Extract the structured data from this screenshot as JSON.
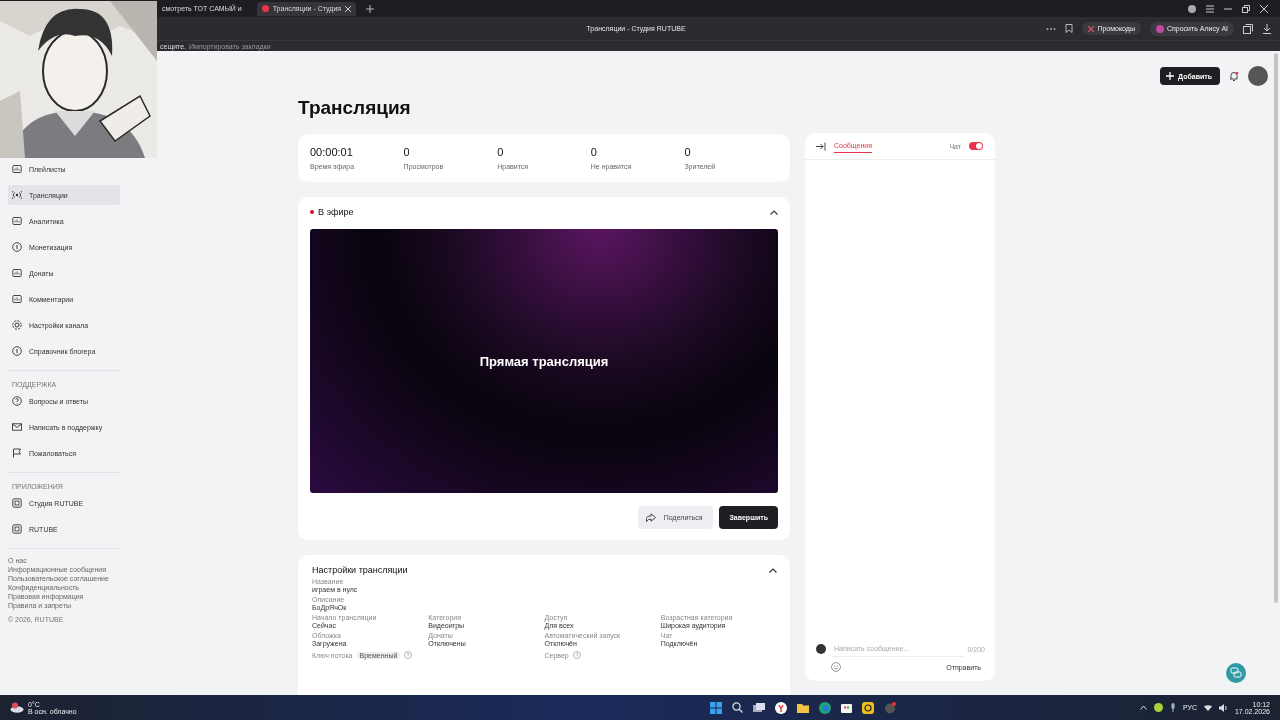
{
  "browser": {
    "tabs": [
      {
        "label": "смотреть ТОТ САМЫЙ и",
        "selected": false
      },
      {
        "label": "Трансляции - Студия",
        "selected": true
      }
    ],
    "page_title": "Трансляции - Студия RUTUBE",
    "promo": "Промокоды",
    "assistant": "Спросить Алису AI",
    "bookmarks_hint": "сещите.",
    "bookmarks_link": "Импортировать закладки"
  },
  "header": {
    "add_button": "Добавить"
  },
  "sidebar": {
    "items": [
      {
        "label": "Плейлисты",
        "selected": false
      },
      {
        "label": "Трансляции",
        "selected": true
      },
      {
        "label": "Аналитика",
        "selected": false
      },
      {
        "label": "Монетизация",
        "selected": false
      },
      {
        "label": "Донаты",
        "selected": false
      },
      {
        "label": "Комментарии",
        "selected": false
      },
      {
        "label": "Настройки канала",
        "selected": false
      },
      {
        "label": "Справочник блогера",
        "selected": false
      }
    ],
    "support_title": "ПОДДЕРЖКА",
    "support_items": [
      {
        "label": "Вопросы и ответы",
        "selected": false
      },
      {
        "label": "Написать в поддержку",
        "selected": false
      },
      {
        "label": "Пожаловаться",
        "selected": false
      }
    ],
    "apps_title": "ПРИЛОЖЕНИЯ",
    "apps_items": [
      {
        "label": "Студия RUTUBE",
        "selected": false
      },
      {
        "label": "RUTUBE",
        "selected": false
      }
    ],
    "footer_links": [
      "О нас",
      "Информационные сообщения",
      "Пользовательское соглашение",
      "Конфиденциальность",
      "Правовая информация",
      "Правила и запреты"
    ],
    "copyright": "© 2026, RUTUBE"
  },
  "title": "Трансляция",
  "stats": [
    {
      "value": "00:00:01",
      "label": "Время эфира"
    },
    {
      "value": "0",
      "label": "Просмотров"
    },
    {
      "value": "0",
      "label": "Нравится"
    },
    {
      "value": "0",
      "label": "Не нравится"
    },
    {
      "value": "0",
      "label": "Зрителей"
    }
  ],
  "live": {
    "status": "В эфире",
    "on_air": true,
    "preview_text": "Прямая трансляция",
    "share_button": "Поделиться",
    "end_button": "Завершить"
  },
  "settings": {
    "title": "Настройки трансляции",
    "name_label": "Название",
    "name_value": "играем в нулс",
    "description_label": "Описание",
    "description_value": "БоДрЯчОк",
    "fields": [
      {
        "label": "Начало трансляции",
        "value": "Сейчас"
      },
      {
        "label": "Категория",
        "value": "Видеоигры"
      },
      {
        "label": "Доступ",
        "value": "Для всех"
      },
      {
        "label": "Возрастная категория",
        "value": "Широкая аудитория"
      },
      {
        "label": "Обложка",
        "value": "Загружена"
      },
      {
        "label": "Донаты",
        "value": "Отключены"
      },
      {
        "label": "Автоматический запуск",
        "value": "Отключён"
      },
      {
        "label": "Чат",
        "value": "Подключён"
      }
    ],
    "stream_key_label": "Ключ потока",
    "stream_key_badge": "Временный",
    "server_label": "Сервер"
  },
  "chat": {
    "tab": "Сообщения",
    "toggle_label": "Чат",
    "toggle_on": true,
    "placeholder": "Написать сообщение...",
    "counter": "0/200",
    "send": "Отправить"
  },
  "taskbar": {
    "weather_temp": "0°C",
    "weather_text": "В осн. облачно",
    "language": "РУС",
    "time": "10:12",
    "date": "17.02.2026"
  }
}
